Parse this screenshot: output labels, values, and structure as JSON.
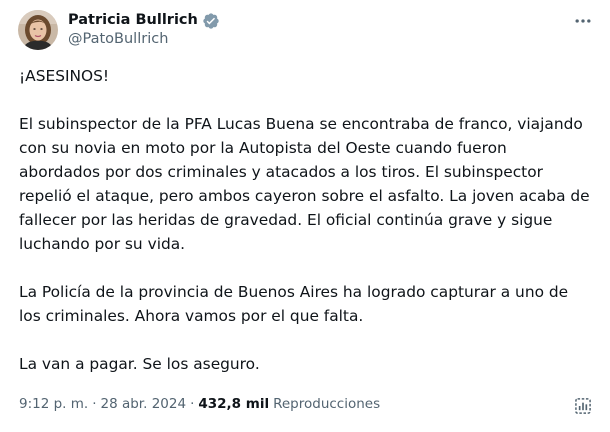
{
  "author": {
    "display_name": "Patricia Bullrich",
    "handle": "@PatoBullrich",
    "verified_badge_color": "#829aab",
    "avatar_icon": "avatar-photo"
  },
  "more_icon": "more-horizontal-icon",
  "body": {
    "p1": "¡ASESINOS!",
    "p2": "El subinspector de la PFA Lucas Buena se encontraba de franco, viajando con su novia en moto por la Autopista del Oeste cuando fueron abordados por dos criminales y atacados a los tiros. El subinspector repelió el ataque, pero ambos cayeron sobre el asfalto. La joven acaba de fallecer por las heridas de gravedad. El oficial continúa grave y sigue luchando por su vida.",
    "p3": "La Policía de la provincia de Buenos Aires ha logrado capturar a uno de los criminales. Ahora vamos por el que falta.",
    "p4": "La van a pagar. Se los aseguro."
  },
  "meta": {
    "time": "9:12 p. m.",
    "separator": "·",
    "date": "28 abr. 2024",
    "views_count": "432,8 mil",
    "views_label": "Reproducciones"
  },
  "analytics_icon": "analytics-icon",
  "colors": {
    "text": "#0f1419",
    "secondary": "#536471"
  }
}
